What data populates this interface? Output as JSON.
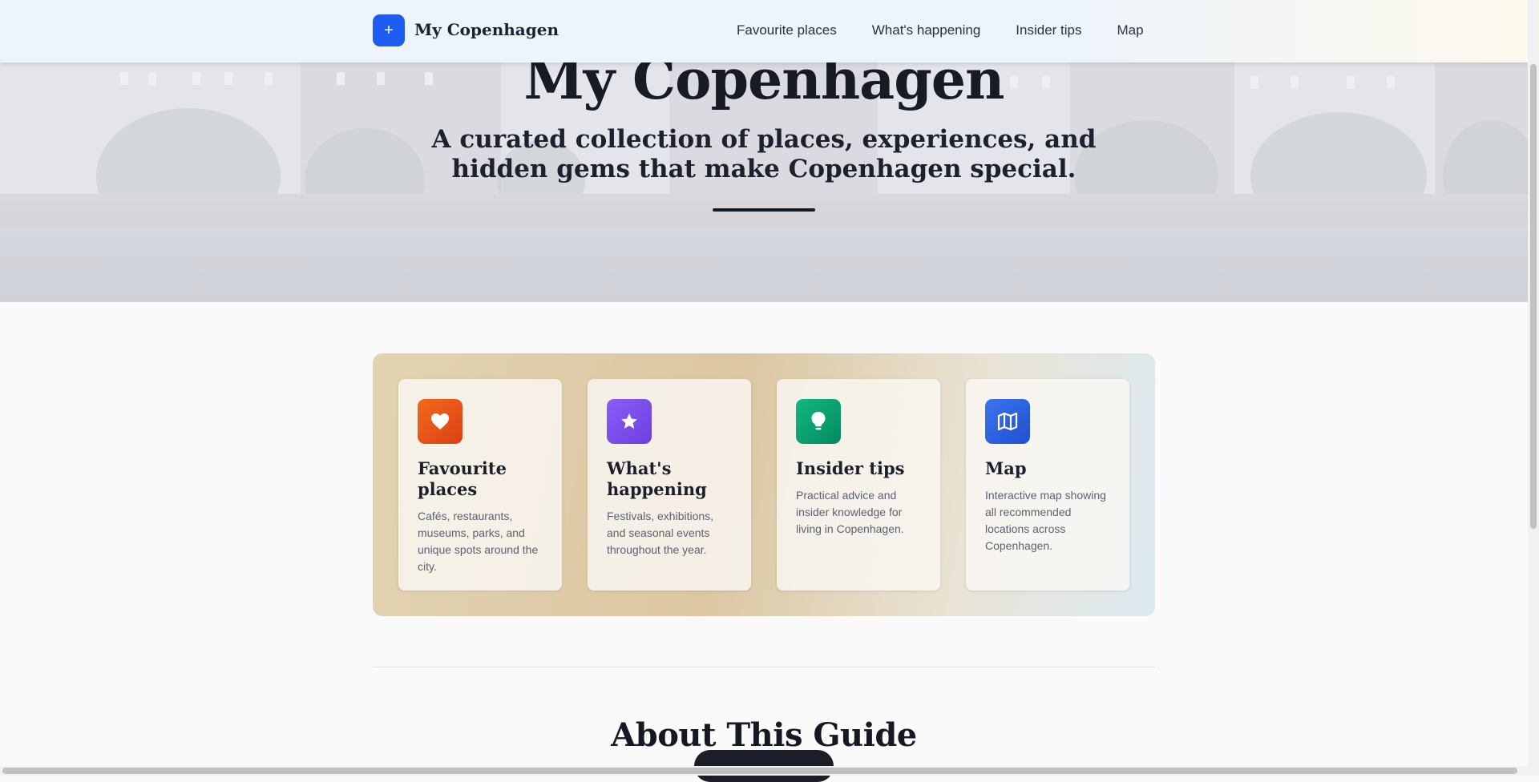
{
  "nav": {
    "logo_glyph": "+",
    "logo_text": "My Copenhagen",
    "links": [
      "Favourite places",
      "What's happening",
      "Insider tips",
      "Map"
    ]
  },
  "hero": {
    "title": "My Copenhagen",
    "subtitle_line1": "A curated collection of places, experiences, and",
    "subtitle_line2": "hidden gems that make Copenhagen special."
  },
  "features": [
    {
      "icon": "heart-icon",
      "color": "#ea580c",
      "title": "Favourite places",
      "text": "Cafés, restaurants, museums, parks, and unique spots around the city."
    },
    {
      "icon": "star-icon",
      "color": "#7c3aed",
      "title": "What's happening",
      "text": "Festivals, exhibitions, and seasonal events throughout the year."
    },
    {
      "icon": "lightbulb-icon",
      "color": "#059669",
      "title": "Insider tips",
      "text": "Practical advice and insider knowledge for living in Copenhagen."
    },
    {
      "icon": "map-icon",
      "color": "#2563eb",
      "title": "Map",
      "text": "Interactive map showing all recommended locations across Copenhagen."
    }
  ],
  "about": {
    "title": "About This Guide"
  }
}
